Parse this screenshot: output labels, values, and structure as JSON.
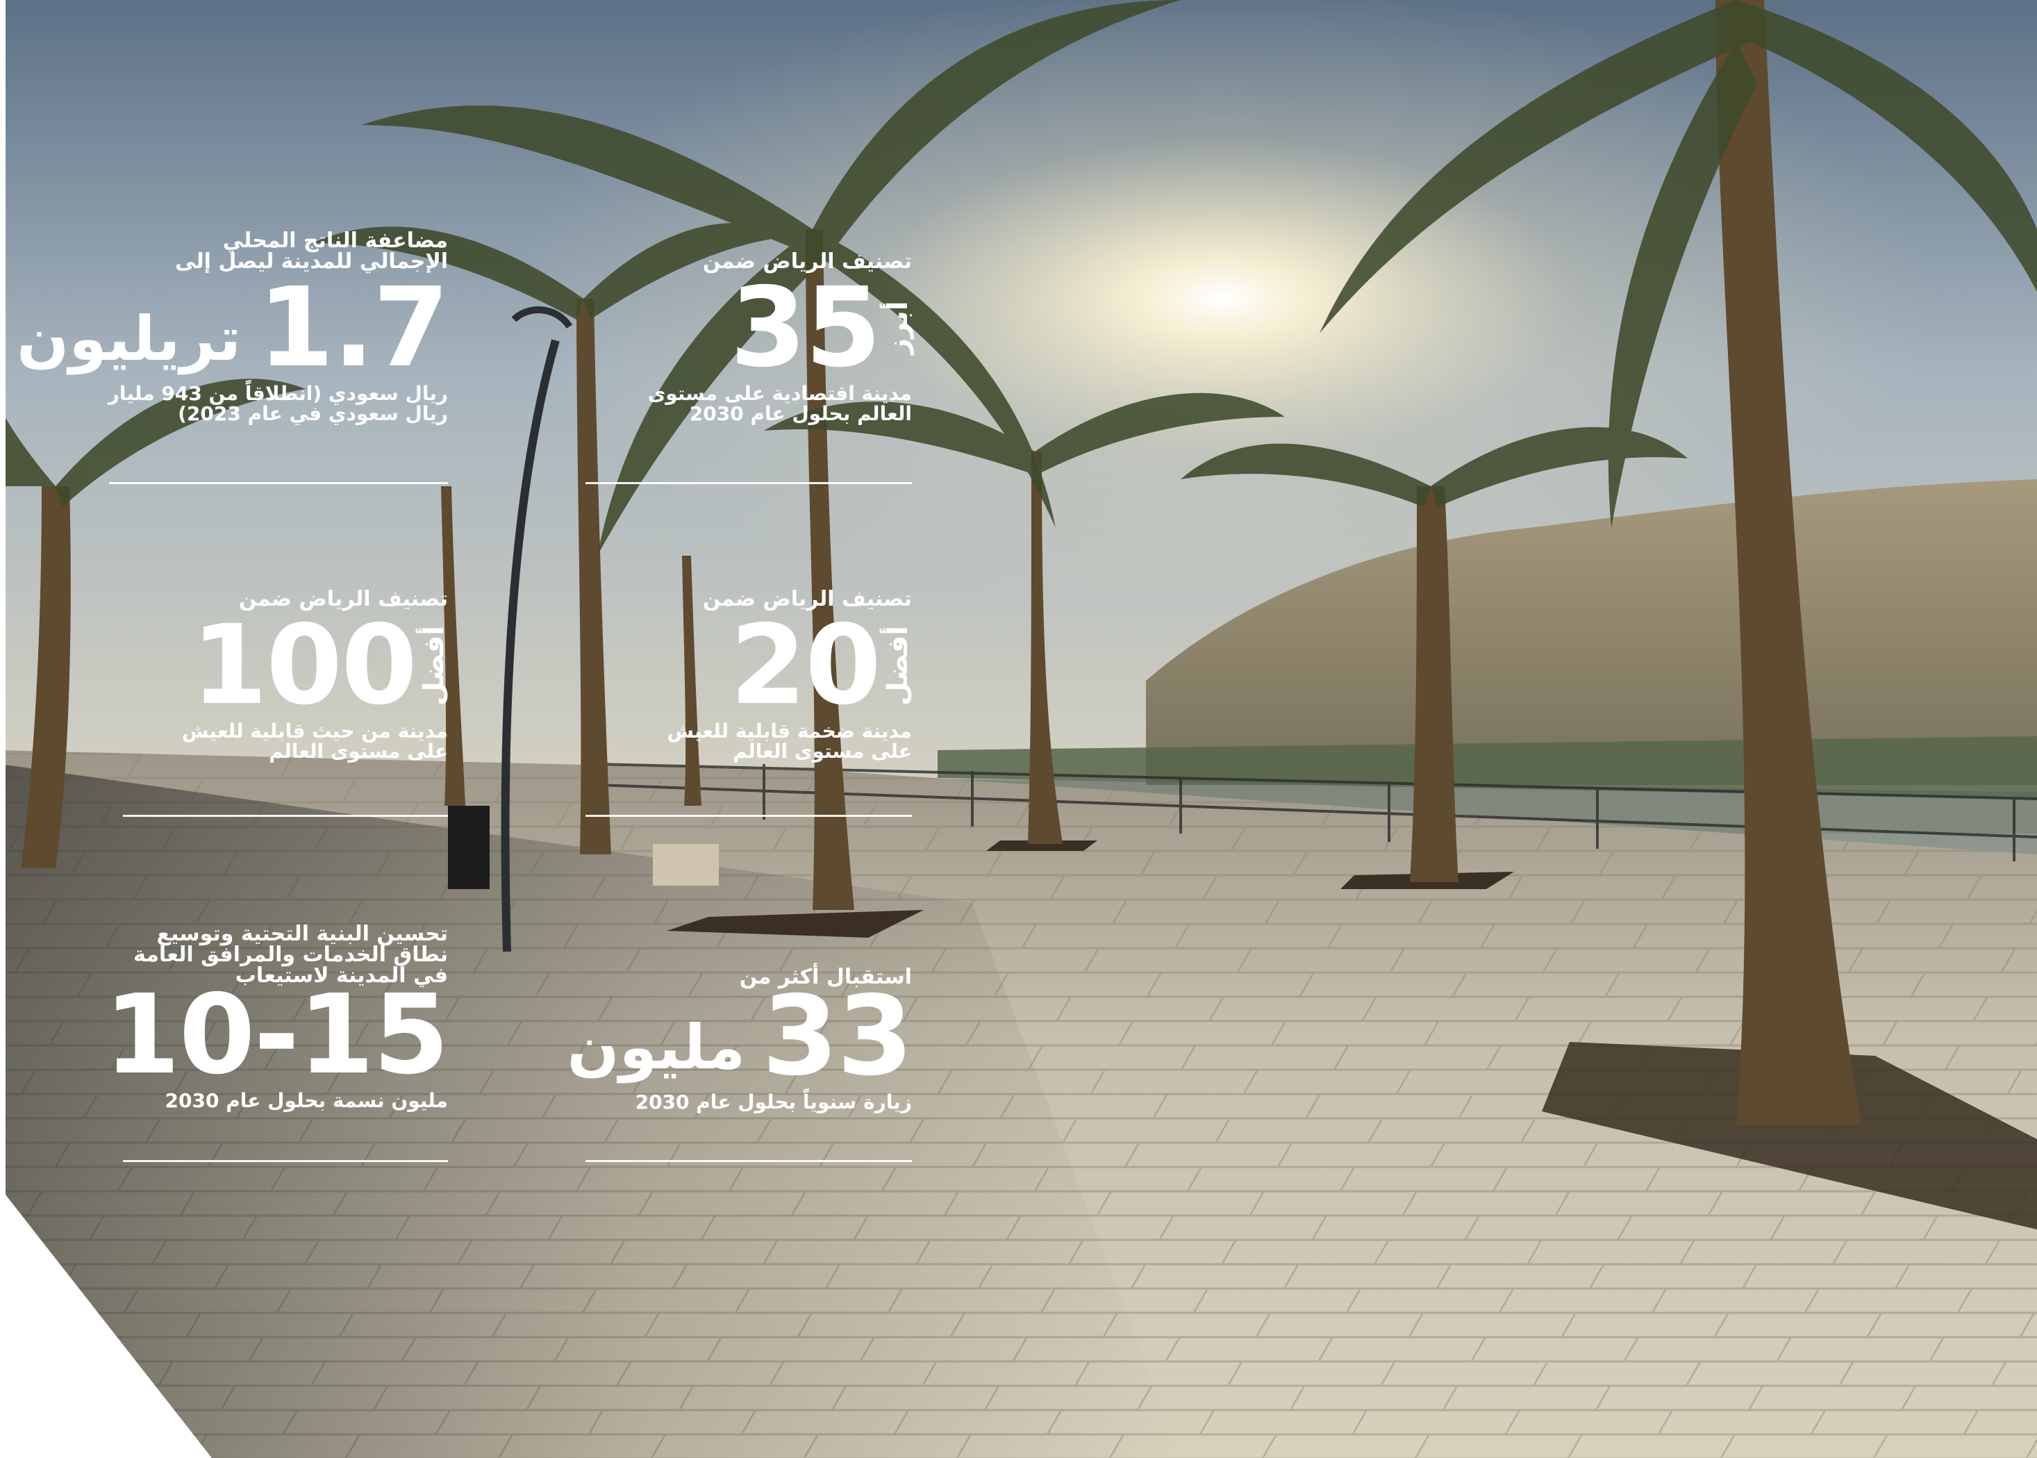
{
  "stats": [
    {
      "caption_lines": [
        "مضاعفة الناتج المحلي",
        "الإجمالي للمدينة ليصل إلى"
      ],
      "qualifier": "",
      "number": "1.7",
      "unit": "تريليون",
      "subtitle_lines": [
        "ريال سعودي (انطلاقاً من 943 مليار",
        "ريال سعودي في عام 2023)"
      ]
    },
    {
      "caption_lines": [
        "تصنيف الرياض ضمن"
      ],
      "qualifier": "أبرز",
      "number": "35",
      "unit": "",
      "subtitle_lines": [
        "مدينة اقتصادية على مستوى",
        "العالم بحلول عام 2030"
      ]
    },
    {
      "caption_lines": [
        "تصنيف الرياض ضمن"
      ],
      "qualifier": "أفضل",
      "number": "100",
      "unit": "",
      "subtitle_lines": [
        "مدينة من حيث قابلية للعيش",
        "على مستوى العالم"
      ]
    },
    {
      "caption_lines": [
        "تصنيف الرياض ضمن"
      ],
      "qualifier": "أفضل",
      "number": "20",
      "unit": "",
      "subtitle_lines": [
        "مدينة ضخمة قابلية للعيش",
        "على مستوى العالم"
      ]
    },
    {
      "caption_lines": [
        "تحسين البنية التحتية وتوسيع",
        "نطاق الخدمات والمرافق العامة",
        "في المدينة لاستيعاب"
      ],
      "qualifier": "",
      "number": "10-15",
      "unit": "",
      "subtitle_lines": [
        "مليون نسمة بحلول عام 2030"
      ]
    },
    {
      "caption_lines": [
        "استقبال أكثر من"
      ],
      "qualifier": "",
      "number": "33",
      "unit": "مليون",
      "subtitle_lines": [
        "زيارة سنوياً بحلول عام 2030"
      ]
    }
  ]
}
